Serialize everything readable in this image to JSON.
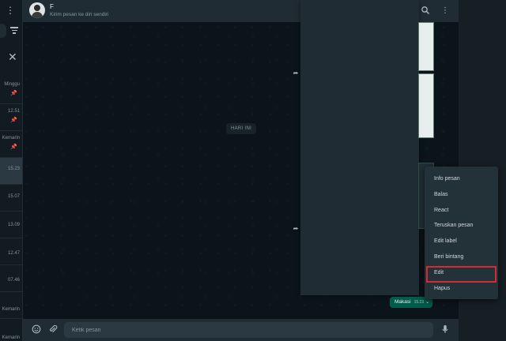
{
  "sidebar": {
    "rows": [
      {
        "time": "Minggu",
        "pinned": true
      },
      {
        "time": "12.51",
        "pinned": true
      },
      {
        "time": "Kemarin",
        "pinned": true
      },
      {
        "time": "15.23",
        "pinned": false,
        "active": true
      },
      {
        "time": "15.07",
        "pinned": false
      },
      {
        "time": "13.09",
        "pinned": false
      },
      {
        "time": "12.47",
        "pinned": false
      },
      {
        "time": "07.46",
        "pinned": false
      },
      {
        "time": "Kemarin",
        "pinned": false
      },
      {
        "time": "Kemarin",
        "pinned": false
      }
    ]
  },
  "header": {
    "contact_name": "F                         ",
    "subtitle": "Kirim pesan ke diri sendiri"
  },
  "chat": {
    "date_label": "HARI INI",
    "outgoing_message": {
      "text": "Makasi",
      "time": "15.23"
    }
  },
  "context_menu": {
    "items": [
      "Info pesan",
      "Balas",
      "React",
      "Teruskan pesan",
      "Edit label",
      "Beri bintang",
      "Edit",
      "Hapus"
    ],
    "highlighted": "Edit"
  },
  "composer": {
    "placeholder": "Ketik pesan"
  },
  "colors": {
    "accent_bubble": "#005c4b",
    "highlight_box": "#d42a33",
    "panel": "#202c33"
  },
  "icons": [
    "menu-icon",
    "filter-icon",
    "close-icon",
    "pin-icon",
    "search-icon",
    "store-icon",
    "more-vert-icon",
    "forward-icon",
    "emoji-icon",
    "attach-icon",
    "mic-icon",
    "chevron-down-icon"
  ]
}
